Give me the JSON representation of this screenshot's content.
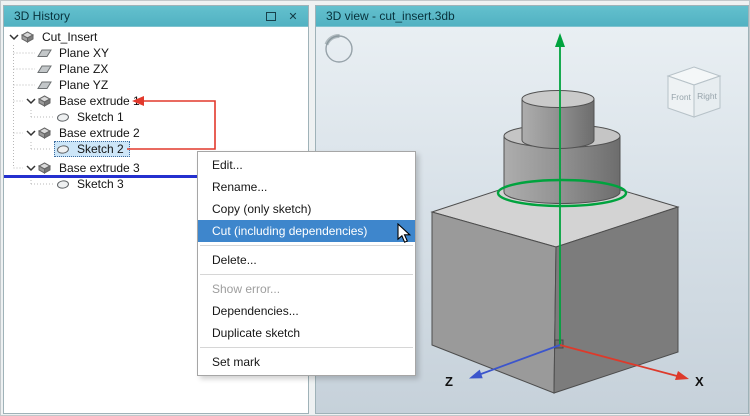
{
  "window": {
    "left_title": "3D History",
    "right_title": "3D view - cut_insert.3db",
    "close_glyph": "✕"
  },
  "tree": {
    "items": [
      {
        "label": "Cut_Insert"
      },
      {
        "label": "Plane XY"
      },
      {
        "label": "Plane ZX"
      },
      {
        "label": "Plane YZ"
      },
      {
        "label": "Base extrude 1"
      },
      {
        "label": "Sketch 1"
      },
      {
        "label": "Base extrude 2"
      },
      {
        "label": "Sketch 2"
      },
      {
        "label": "Base extrude 3"
      },
      {
        "label": "Sketch 3"
      }
    ],
    "selected_item": "Sketch 2"
  },
  "menu": {
    "edit": "Edit...",
    "rename": "Rename...",
    "copy": "Copy (only sketch)",
    "cut": "Cut (including dependencies)",
    "delete": "Delete...",
    "show_error": "Show error...",
    "dependencies": "Dependencies...",
    "duplicate": "Duplicate sketch",
    "set_mark": "Set mark",
    "highlighted_item": "Cut (including dependencies)"
  },
  "viewport": {
    "axis_x": "X",
    "axis_z": "Z",
    "cube_front": "Front",
    "cube_right": "Right"
  },
  "colors": {
    "titlebar": "#58b8c8",
    "menu_highlight": "#3e86cc",
    "selection_fill": "#cde6f8",
    "insert_line": "#2430cf",
    "move_connector": "#e2392c",
    "axis_x": "#dd3a2b",
    "axis_y": "#00a33e",
    "axis_z": "#3b55cc"
  }
}
